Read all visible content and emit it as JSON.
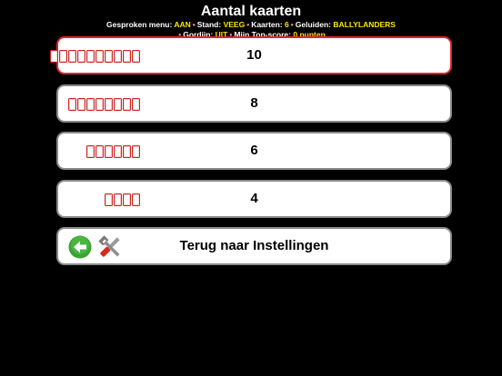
{
  "header": {
    "title": "Aantal kaarten",
    "status": {
      "menu_label": "Gesproken menu:",
      "menu_value": "AAN",
      "stand_label": "Stand:",
      "stand_value": "VEEG",
      "kaarten_label": "Kaarten:",
      "kaarten_value": "6",
      "geluiden_label": "Geluiden:",
      "geluiden_value": "BALLYLANDERS",
      "gordijn_label": "Gordijn:",
      "gordijn_value": "UIT",
      "topscore_label": "Mijn Top-score:",
      "topscore_value": "0 punten",
      "separator": "•"
    }
  },
  "options": [
    {
      "value": "10",
      "cards": 10,
      "selected": true
    },
    {
      "value": "8",
      "cards": 8,
      "selected": false
    },
    {
      "value": "6",
      "cards": 6,
      "selected": false
    },
    {
      "value": "4",
      "cards": 4,
      "selected": false
    }
  ],
  "back": {
    "label": "Terug naar Instellingen",
    "icons": [
      "back-arrow-icon",
      "tools-icon"
    ]
  },
  "colors": {
    "background": "#000000",
    "accent_value": "#ffe600",
    "separator": "#ff9a9a",
    "selected_border": "#e3252a",
    "card_red": "#d0211f",
    "back_green": "#3aa335"
  }
}
